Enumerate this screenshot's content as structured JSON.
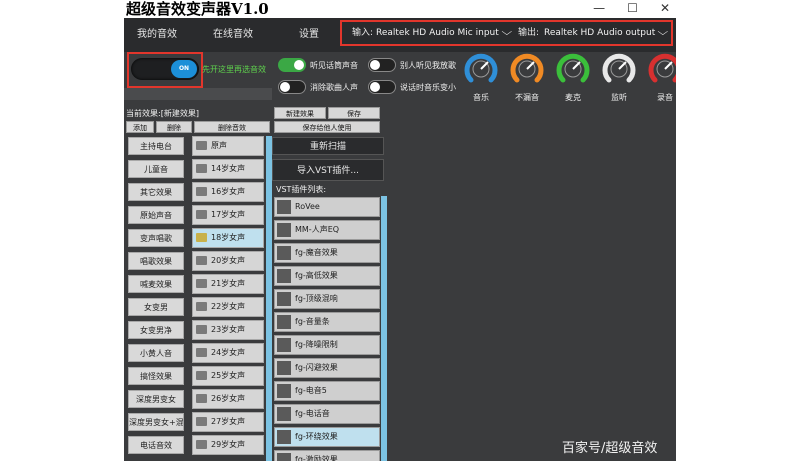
{
  "window": {
    "title": "超级音效变声器V1.0",
    "minimize_glyph": "—",
    "maximize_glyph": "☐",
    "close_glyph": "✕"
  },
  "nav": {
    "my_effects": "我的音效",
    "online_effects": "在线音效",
    "settings": "设置"
  },
  "io": {
    "input_label": "输入:",
    "input_value": "Realtek HD Audio Mic input",
    "output_label": "输出:",
    "output_value": "Realtek HD Audio output",
    "chevron": "❯"
  },
  "controls": {
    "main_toggle_text": "ON",
    "main_toggle_hint": "先开这里再选音效",
    "switches": [
      {
        "label": "听见话筒声音",
        "on": true
      },
      {
        "label": "别人听见我放歌",
        "on": false
      },
      {
        "label": "消除歌曲人声",
        "on": false
      },
      {
        "label": "说话时音乐变小",
        "on": false
      }
    ],
    "gauges": [
      {
        "label": "音乐",
        "color": "#2f8fd8",
        "icon": "gauge-icon"
      },
      {
        "label": "不漏音",
        "color": "#f08a24",
        "icon": "gauge-icon"
      },
      {
        "label": "麦克",
        "color": "#3bbf3b",
        "icon": "gauge-icon"
      },
      {
        "label": "监听",
        "color": "#e8e8e8",
        "icon": "gauge-icon"
      },
      {
        "label": "录音",
        "color": "#d83030",
        "icon": "gauge-icon"
      }
    ]
  },
  "current_effect_label": "当前效果:[新建效果]",
  "buttons": {
    "add": "添加",
    "remove": "删除",
    "delete_sound": "删除音效",
    "new_effect": "新建效果",
    "save": "保存",
    "save_for_others": "保存给他人使用",
    "rescan": "重新扫描",
    "import_vst": "导入VST插件..."
  },
  "effects": [
    "主持电台",
    "儿童音",
    "其它效果",
    "原始声音",
    "变声唱歌",
    "唱歌效果",
    "喊麦效果",
    "女变男",
    "女变男净",
    "小黄人音",
    "搞怪效果",
    "深度男变女",
    "深度男变女+混响",
    "电话音效"
  ],
  "voices": [
    "原声",
    "14岁女声",
    "16岁女声",
    "17岁女声",
    "18岁女声",
    "20岁女声",
    "21岁女声",
    "22岁女声",
    "23岁女声",
    "24岁女声",
    "25岁女声",
    "26岁女声",
    "27岁女声",
    "29岁女声"
  ],
  "selected_voice_index": 4,
  "vst_title": "VST插件列表:",
  "vst_plugins": [
    "RoVee",
    "MM-人声EQ",
    "fg-魔音效果",
    "fg-高低效果",
    "fg-顶级混响",
    "fg-音量条",
    "fg-降噪限制",
    "fg-闪避效果",
    "fg-电音5",
    "fg-电话音",
    "fg-环绕效果",
    "fg-激励效果"
  ],
  "selected_vst_index": 10,
  "watermark": "百家号/超级音效",
  "colors": {
    "accent_red": "#e2362c",
    "hint_green": "#5fd34d",
    "toggle_blue": "#1c8fd8",
    "selection_blue": "#bfe0ee"
  }
}
